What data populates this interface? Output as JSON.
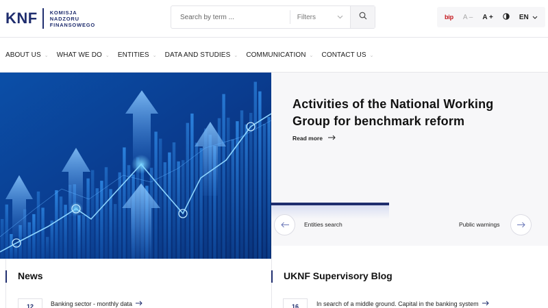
{
  "colors": {
    "brand_navy": "#1f2d6e",
    "bip_red": "#c4161c",
    "panel_bg": "#f7f7f9",
    "hero_blue": "#1a7fd6"
  },
  "logo": {
    "mark": "KNF",
    "line1": "KOMISJA",
    "line2": "NADZORU",
    "line3": "FINANSOWEGO"
  },
  "search": {
    "placeholder": "Search by term ...",
    "filters_label": "Filters",
    "icon": "search-icon"
  },
  "tools": {
    "bip": "bip",
    "font_decrease": "A –",
    "font_increase": "A +",
    "contrast_icon": "contrast-icon",
    "language": "EN"
  },
  "nav": {
    "items": [
      "ABOUT US",
      "WHAT WE DO",
      "ENTITIES",
      "DATA AND STUDIES",
      "COMMUNICATION",
      "CONTACT US"
    ]
  },
  "hero": {
    "title": "Activities of the National Working Group for benchmark reform",
    "read_more": "Read more",
    "entities_search": "Entities search",
    "public_warnings": "Public warnings",
    "image_description": "blue financial bar chart with upward arrows and trend line"
  },
  "news": {
    "title": "News",
    "first_item": "Banking sector - monthly data",
    "first_date": "12"
  },
  "blog": {
    "title": "UKNF Supervisory Blog",
    "first_item": "In search of a middle ground. Capital in the banking system",
    "first_date": "16"
  }
}
